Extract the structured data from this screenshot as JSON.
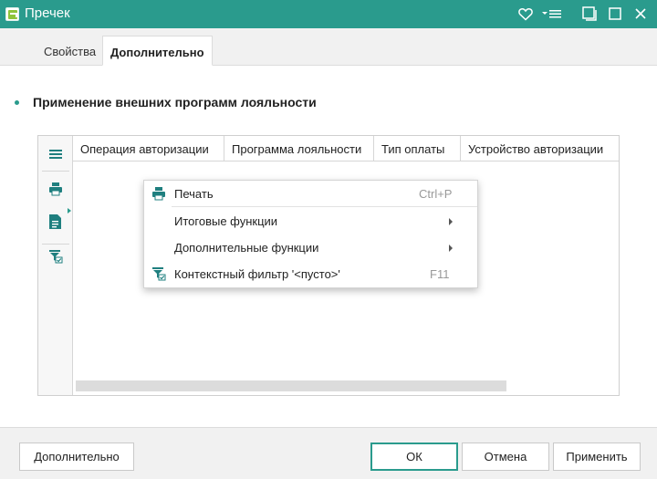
{
  "window": {
    "title": "Пречек"
  },
  "tabs": [
    {
      "label": "Свойства",
      "active": false
    },
    {
      "label": "Дополнительно",
      "active": true
    }
  ],
  "section": {
    "title": "Применение внешних программ лояльности"
  },
  "grid": {
    "columns": [
      "Операция авторизации",
      "Программа лояльности",
      "Тип оплаты",
      "Устройство авторизации"
    ],
    "rows": [],
    "side_icons": [
      "menu-icon",
      "print-icon",
      "document-list-icon",
      "filter-check-icon"
    ]
  },
  "context_menu": {
    "items": [
      {
        "label": "Печать",
        "shortcut": "Ctrl+P",
        "icon": "print-icon"
      },
      {
        "label": "Итоговые функции",
        "submenu": true
      },
      {
        "label": "Дополнительные функции",
        "submenu": true
      },
      {
        "label": "Контекстный фильтр '<пусто>'",
        "shortcut": "F11",
        "icon": "filter-check-icon"
      }
    ]
  },
  "footer": {
    "more_label": "Дополнительно",
    "ok_label": "ОК",
    "cancel_label": "Отмена",
    "apply_label": "Применить"
  },
  "colors": {
    "accent": "#2a9b8d",
    "toolbar_icon": "#1f7f7f"
  }
}
